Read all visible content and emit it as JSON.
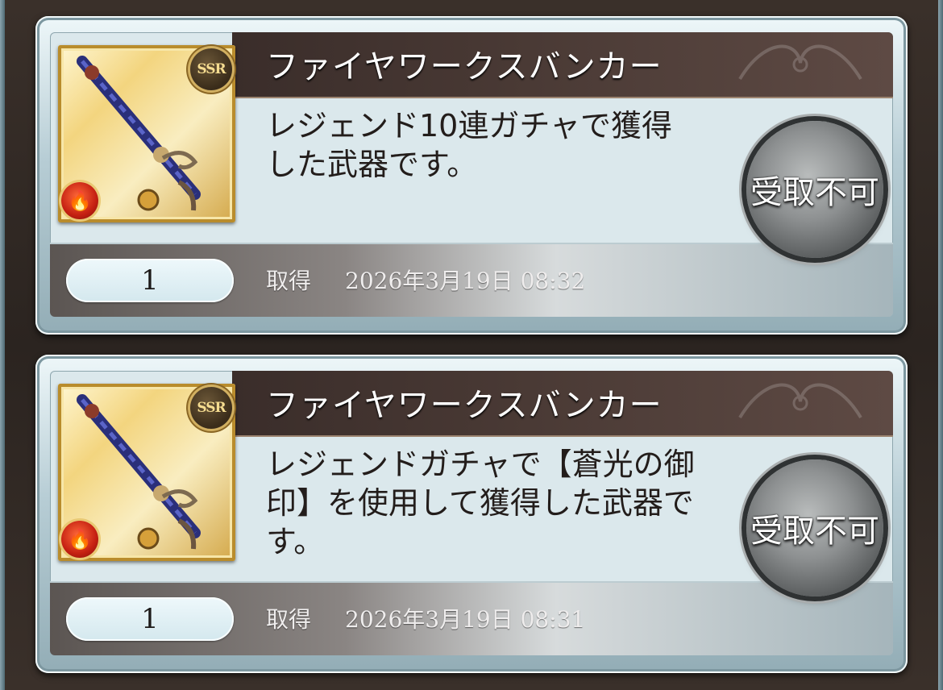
{
  "items": [
    {
      "name": "ファイヤワークスバンカー",
      "rarity": "SSR",
      "description": "レジェンド10連ガチャで獲得した武器です。",
      "quantity": "1",
      "acquired_label": "取得",
      "acquired_date": "2026年3月19日  08:32",
      "claim_label": "受取不可"
    },
    {
      "name": "ファイヤワークスバンカー",
      "rarity": "SSR",
      "description": "レジェンドガチャで【蒼光の御印】を使用して獲得した武器です。",
      "quantity": "1",
      "acquired_label": "取得",
      "acquired_date": "2026年3月19日  08:31",
      "claim_label": "受取不可"
    }
  ],
  "icons": {
    "weapon": "fire-lance-icon",
    "element": "fire-element-icon",
    "rarity": "ssr-badge-icon"
  },
  "colors": {
    "title_bar": "#3a2d2a",
    "panel": "#dbe8ec",
    "frame": "#b7cdd5",
    "button": "#8d9091"
  }
}
